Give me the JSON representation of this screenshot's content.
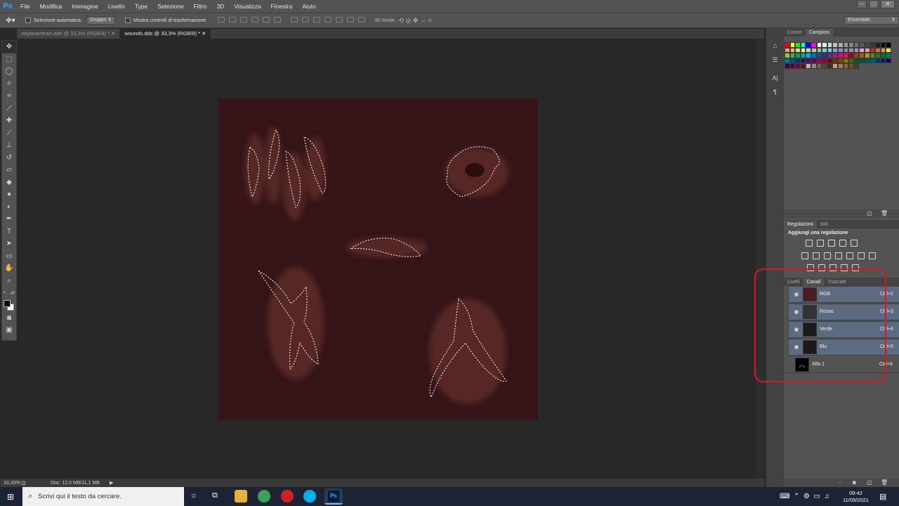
{
  "app": {
    "logo": "Ps"
  },
  "menu": [
    "File",
    "Modifica",
    "Immagine",
    "Livello",
    "Type",
    "Selezione",
    "Filtro",
    "3D",
    "Visualizza",
    "Finestra",
    "Aiuto"
  ],
  "options": {
    "auto_select_label": "Selezione automatica:",
    "auto_select_value": "Gruppo",
    "transform_label": "Mostra controlli di trasformazione",
    "mode_label": "3D Mode:",
    "workspace": "Essentials"
  },
  "tabs": [
    {
      "label": "odybriarheart.dds @ 33,3% (RGB/8) *",
      "active": false
    },
    {
      "label": "wounds.dds @ 33,3% (RGB/8) *",
      "active": true
    }
  ],
  "status": {
    "zoom": "33,33%",
    "doc": "Doc: 12,0 MB/11,1 MB"
  },
  "swatch_panel": {
    "tabs": [
      "Colore",
      "Campioni"
    ],
    "active_tab": "Campioni"
  },
  "adjust_panel": {
    "tabs": [
      "Regolazioni",
      "Stili"
    ],
    "title": "Aggiungi una regolazione"
  },
  "channels_panel": {
    "tabs": [
      "Livelli",
      "Canali",
      "Tracciati"
    ],
    "active_tab": "Canali",
    "rows": [
      {
        "name": "RGB",
        "shortcut": "Ctrl+2",
        "visible": true,
        "selected": true
      },
      {
        "name": "Rosso",
        "shortcut": "Ctrl+3",
        "visible": true,
        "selected": true
      },
      {
        "name": "Verde",
        "shortcut": "Ctrl+4",
        "visible": true,
        "selected": true
      },
      {
        "name": "Blu",
        "shortcut": "Ctrl+5",
        "visible": true,
        "selected": true
      },
      {
        "name": "Alfa 1",
        "shortcut": "Ctrl+6",
        "visible": false,
        "selected": false
      }
    ]
  },
  "taskbar": {
    "search_placeholder": "Scrivi qui il testo da cercare.",
    "time": "09:42",
    "date": "11/09/2021"
  },
  "colors": {
    "canvas": "#351518",
    "highlight": "#e0141e",
    "selection_row": "#5c6b80"
  }
}
